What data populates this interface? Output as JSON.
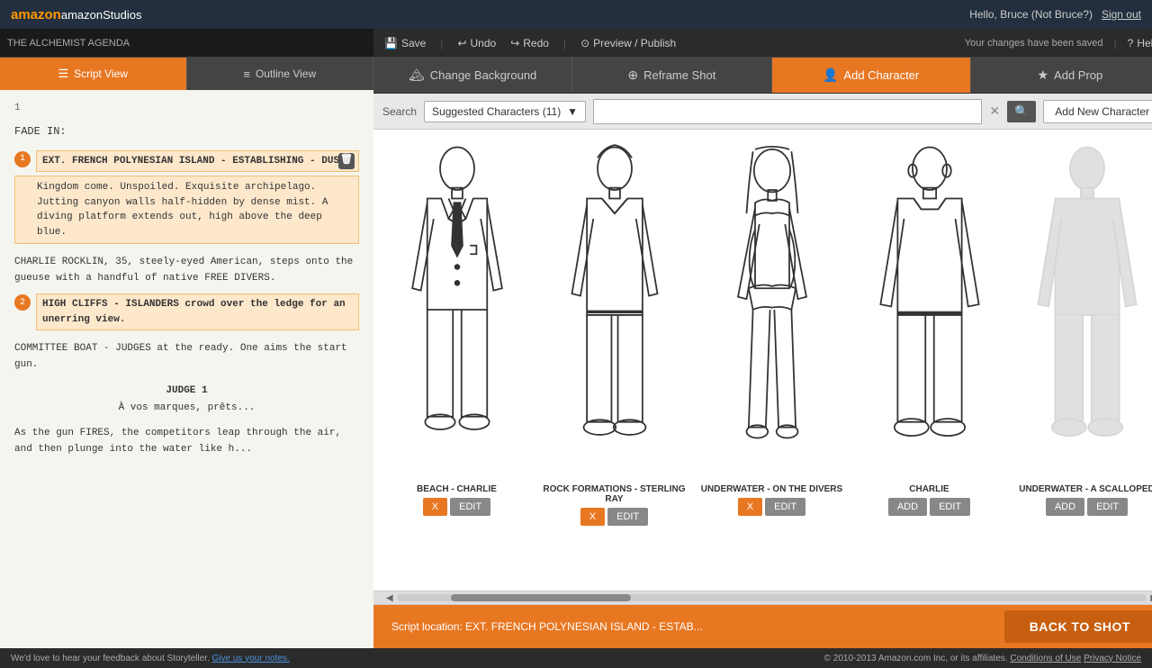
{
  "topbar": {
    "logo": "amazonStudios",
    "user_greeting": "Hello, Bruce (Not Bruce?)",
    "sign_out": "Sign out"
  },
  "left_panel": {
    "project_title": "THE ALCHEMIST AGENDA",
    "tabs": [
      {
        "id": "script",
        "label": "Script View",
        "icon": "☰",
        "active": true
      },
      {
        "id": "outline",
        "label": "Outline View",
        "icon": "≡",
        "active": false
      }
    ],
    "line_number": "1",
    "script_lines": [
      {
        "type": "fade",
        "text": "FADE IN:"
      },
      {
        "type": "scene",
        "num": "1",
        "text": "EXT. FRENCH POLYNESIAN ISLAND - ESTABLISHING - DUSK"
      },
      {
        "type": "action",
        "text": "Kingdom come. Unspoiled. Exquisite archipelago. Jutting canyon walls half-hidden by dense mist. A diving platform extends out, high above the deep blue."
      },
      {
        "type": "action_char",
        "text": "CHARLIE ROCKLIN, 35, steely-eyed American, steps onto the gueuse with a handful of native FREE DIVERS."
      },
      {
        "type": "scene_sub",
        "text": "HIGH CLIFFS - ISLANDERS\ncrowd over the ledge for an unerring view."
      },
      {
        "type": "scene_sub",
        "text": "COMMITTEE BOAT - JUDGES\nat the ready. One aims the start gun."
      },
      {
        "type": "char_name",
        "text": "JUDGE 1"
      },
      {
        "type": "dialog",
        "text": "À vos marques, prêts..."
      },
      {
        "type": "action_char",
        "text": "As the gun FIRES, the competitors leap through the air, and then plunge into the water like h..."
      }
    ]
  },
  "right_panel": {
    "toolbar": {
      "save": "Save",
      "undo": "Undo",
      "redo": "Redo",
      "preview_publish": "Preview / Publish",
      "saved_message": "Your changes have been saved",
      "help": "Help"
    },
    "tabs": [
      {
        "id": "change_bg",
        "label": "Change Background",
        "icon": "🏔",
        "active": false
      },
      {
        "id": "reframe",
        "label": "Reframe Shot",
        "icon": "⊕",
        "active": false
      },
      {
        "id": "add_char",
        "label": "Add Character",
        "icon": "👤",
        "active": true
      },
      {
        "id": "add_prop",
        "label": "Add Prop",
        "icon": "★",
        "active": false
      }
    ],
    "search": {
      "label": "Search",
      "dropdown_value": "Suggested Characters (11)",
      "input_placeholder": "",
      "add_new_label": "Add New Character"
    },
    "characters": [
      {
        "id": "beach_charlie",
        "name": "BEACH - CHARLIE",
        "type": "suit_male",
        "added": true
      },
      {
        "id": "rock_sterling",
        "name": "ROCK FORMATIONS - STERLING RAY",
        "type": "casual_male",
        "added": true
      },
      {
        "id": "underwater_divers",
        "name": "UNDERWATER - ON THE DIVERS",
        "type": "bikini_female",
        "added": true
      },
      {
        "id": "charlie",
        "name": "CHARLIE",
        "type": "tshirt_male",
        "added": false
      },
      {
        "id": "underwater_scalloped",
        "name": "UNDERWATER - A SCALLOPED",
        "type": "ghost",
        "added": false
      }
    ],
    "bottom_bar": {
      "script_location": "Script location: EXT. FRENCH POLYNESIAN ISLAND - ESTAB...",
      "back_to_shot": "BACK TO SHOT"
    }
  },
  "footer": {
    "feedback": "We'd love to hear your feedback about Storyteller.",
    "feedback_link": "Give us your notes.",
    "copyright": "© 2010-2013 Amazon.com Inc, or its affiliates.",
    "conditions": "Conditions of Use",
    "privacy": "Privacy Notice"
  }
}
